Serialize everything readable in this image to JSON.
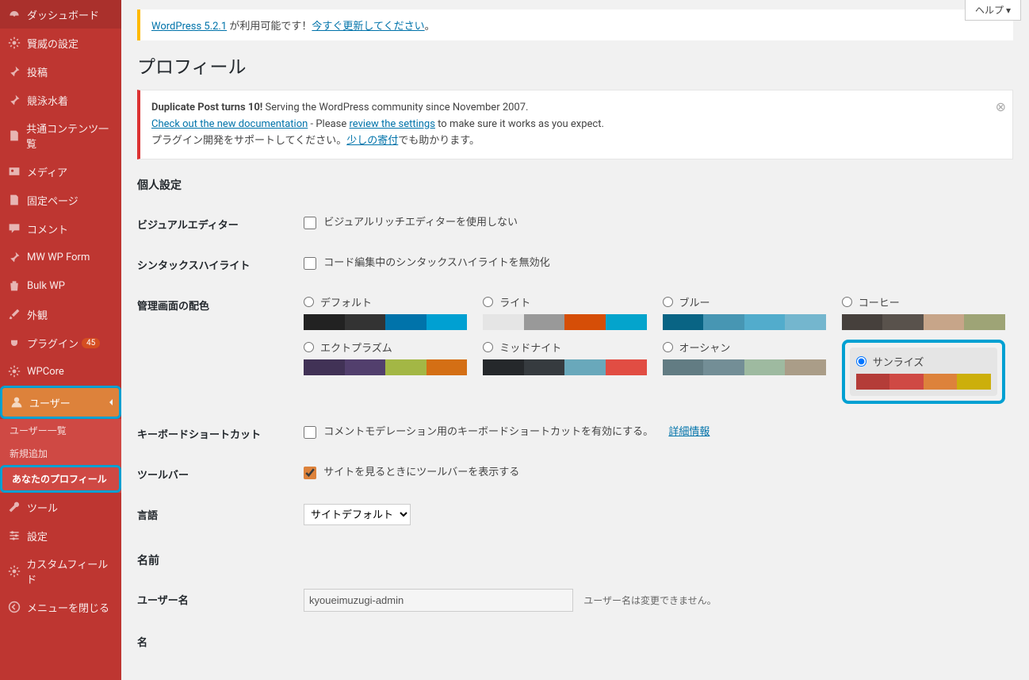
{
  "help_tab": "ヘルプ ▾",
  "update_notice": {
    "prefix": "WordPress 5.2.1",
    "mid": " が利用可能です！",
    "link": "今すぐ更新してください",
    "suffix": "。"
  },
  "page_title": "プロフィール",
  "dup_notice": {
    "bold": "Duplicate Post turns 10!",
    "line1_rest": " Serving the WordPress community since November 2007.",
    "doc_link": "Check out the new documentation",
    "line2_mid": " - Please ",
    "settings_link": "review the settings",
    "line2_end": " to make sure it works as you expect.",
    "line3_pre": "プラグイン開発をサポートしてください。",
    "donate_link": "少しの寄付",
    "line3_end": "でも助かります。"
  },
  "sections": {
    "personal": "個人設定",
    "name": "名前"
  },
  "labels": {
    "visual_editor": "ビジュアルエディター",
    "visual_editor_cb": "ビジュアルリッチエディターを使用しない",
    "syntax": "シンタックスハイライト",
    "syntax_cb": "コード編集中のシンタックスハイライトを無効化",
    "color_scheme": "管理画面の配色",
    "shortcuts": "キーボードショートカット",
    "shortcuts_cb": "コメントモデレーション用のキーボードショートカットを有効にする。",
    "shortcuts_link": "詳細情報",
    "toolbar": "ツールバー",
    "toolbar_cb": "サイトを見るときにツールバーを表示する",
    "language": "言語",
    "language_val": "サイトデフォルト",
    "username": "ユーザー名",
    "username_val": "kyoueimuzugi-admin",
    "username_desc": "ユーザー名は変更できません。",
    "lastname": "名"
  },
  "schemes": [
    {
      "name": "デフォルト",
      "colors": [
        "#222",
        "#333",
        "#0073aa",
        "#00a0d2"
      ],
      "checked": false
    },
    {
      "name": "ライト",
      "colors": [
        "#e5e5e5",
        "#999",
        "#d64e07",
        "#04a4cc"
      ],
      "checked": false
    },
    {
      "name": "ブルー",
      "colors": [
        "#096484",
        "#4796b3",
        "#52accc",
        "#74B6CE"
      ],
      "checked": false
    },
    {
      "name": "コーヒー",
      "colors": [
        "#46403c",
        "#59524c",
        "#c7a589",
        "#9ea476"
      ],
      "checked": false
    },
    {
      "name": "エクトプラズム",
      "colors": [
        "#413256",
        "#523f6d",
        "#a3b745",
        "#d46f15"
      ],
      "checked": false
    },
    {
      "name": "ミッドナイト",
      "colors": [
        "#25282b",
        "#363b3f",
        "#69a8bb",
        "#e14d43"
      ],
      "checked": false
    },
    {
      "name": "オーシャン",
      "colors": [
        "#627c83",
        "#738e96",
        "#9ebaa0",
        "#aa9d88"
      ],
      "checked": false
    },
    {
      "name": "サンライズ",
      "colors": [
        "#b43c38",
        "#cf4944",
        "#dd823b",
        "#ccaf0b"
      ],
      "checked": true
    }
  ],
  "sidebar": {
    "items": [
      {
        "label": "ダッシュボード",
        "icon": "dashboard"
      },
      {
        "label": "賢威の設定",
        "icon": "gear"
      },
      {
        "label": "投稿",
        "icon": "pin"
      },
      {
        "label": "競泳水着",
        "icon": "pin"
      },
      {
        "label": "共通コンテンツ一覧",
        "icon": "doc"
      },
      {
        "label": "メディア",
        "icon": "media"
      },
      {
        "label": "固定ページ",
        "icon": "doc"
      },
      {
        "label": "コメント",
        "icon": "comment"
      },
      {
        "label": "MW WP Form",
        "icon": "pin"
      },
      {
        "label": "Bulk WP",
        "icon": "trash"
      },
      {
        "label": "外観",
        "icon": "brush"
      },
      {
        "label": "プラグイン",
        "icon": "plug",
        "badge": "45"
      },
      {
        "label": "WPCore",
        "icon": "gear"
      },
      {
        "label": "ユーザー",
        "icon": "user",
        "current": true
      },
      {
        "label": "ツール",
        "icon": "wrench"
      },
      {
        "label": "設定",
        "icon": "sliders"
      },
      {
        "label": "カスタムフィールド",
        "icon": "gear"
      },
      {
        "label": "メニューを閉じる",
        "icon": "collapse"
      }
    ],
    "submenu": [
      {
        "label": "ユーザー一覧"
      },
      {
        "label": "新規追加"
      },
      {
        "label": "あなたのプロフィール",
        "current": true
      }
    ]
  }
}
